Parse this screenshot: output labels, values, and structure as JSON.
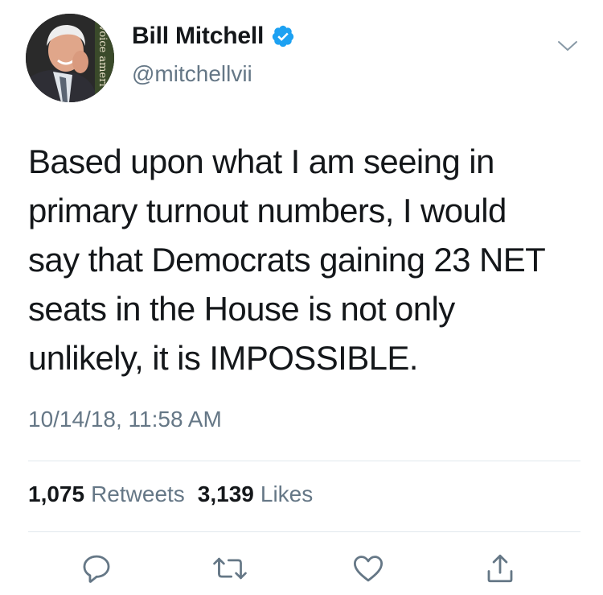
{
  "author": {
    "display_name": "Bill Mitchell",
    "handle": "@mitchellvii",
    "verified": true,
    "avatar_background_text": "voice ameri"
  },
  "tweet": {
    "text": "Based upon what I am seeing in\nprimary turnout numbers, I would\nsay that Democrats gaining 23 NET\nseats in the House is not only\nunlikely, it is IMPOSSIBLE.",
    "timestamp": "10/14/18, 11:58 AM"
  },
  "stats": {
    "retweets_count": "1,075",
    "retweets_label": "Retweets",
    "likes_count": "3,139",
    "likes_label": "Likes"
  },
  "actions": {
    "reply_icon": "reply-icon",
    "retweet_icon": "retweet-icon",
    "like_icon": "heart-icon",
    "share_icon": "share-icon"
  },
  "colors": {
    "text_primary": "#14171a",
    "text_secondary": "#657786",
    "verified_blue": "#1da1f2",
    "divider": "#e1e8ed"
  }
}
